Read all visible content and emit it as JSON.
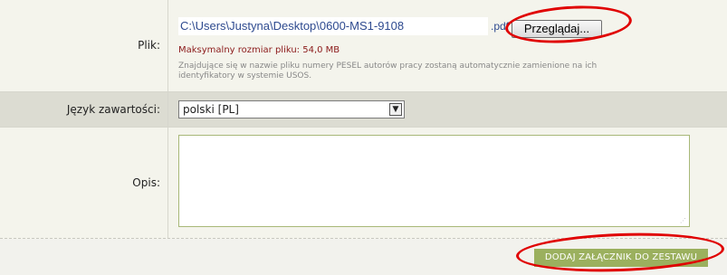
{
  "file_row": {
    "label": "Plik:",
    "path_value": "C:\\Users\\Justyna\\Desktop\\0600-MS1-9108",
    "path_ext": ".pdf",
    "browse_label": "Przeglądaj...",
    "max_size": "Maksymalny rozmiar pliku: 54,0 MB",
    "hint_line1": "Znajdujące się w nazwie pliku numery PESEL autorów pracy zostaną automatycznie zamienione na ich",
    "hint_line2": "identyfikatory w systemie USOS."
  },
  "language_row": {
    "label": "Język zawartości:",
    "selected": "polski [PL]"
  },
  "description_row": {
    "label": "Opis:",
    "value": ""
  },
  "submit": {
    "label": "DODAJ ZAŁĄCZNIK DO ZESTAWU"
  },
  "annotation_color": "#e00000",
  "accent_color": "#9bb05e"
}
